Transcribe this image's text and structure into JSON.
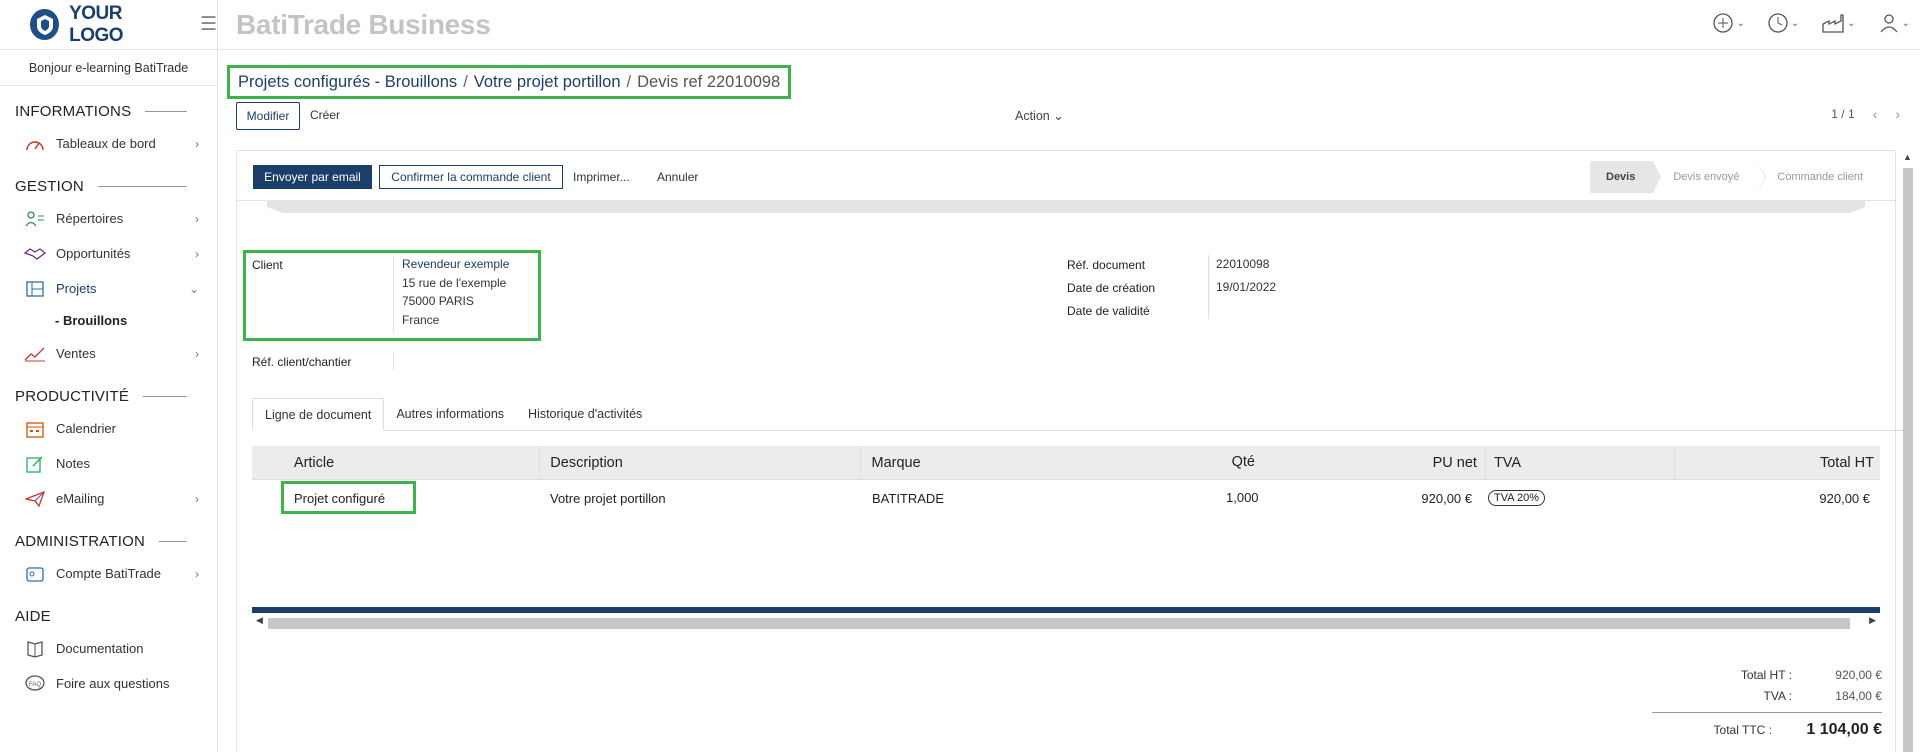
{
  "brand": {
    "logo_text": "YOUR LOGO",
    "app_title": "BatiTrade Business",
    "primary_color": "#1b3f6b",
    "highlight_color": "#3cb44b"
  },
  "sidebar": {
    "greeting": "Bonjour e-learning BatiTrade",
    "sections": [
      {
        "title": "INFORMATIONS",
        "items": [
          {
            "label": "Tableaux de bord",
            "icon": "dashboard-icon"
          }
        ]
      },
      {
        "title": "GESTION",
        "items": [
          {
            "label": "Répertoires",
            "icon": "directory-icon"
          },
          {
            "label": "Opportunités",
            "icon": "handshake-icon"
          },
          {
            "label": "Projets",
            "icon": "blueprint-icon",
            "sub": "- Brouillons"
          },
          {
            "label": "Ventes",
            "icon": "chart-line-icon"
          }
        ]
      },
      {
        "title": "PRODUCTIVITÉ",
        "items": [
          {
            "label": "Calendrier",
            "icon": "calendar-icon"
          },
          {
            "label": "Notes",
            "icon": "note-edit-icon"
          },
          {
            "label": "eMailing",
            "icon": "paper-plane-icon"
          }
        ]
      },
      {
        "title": "ADMINISTRATION",
        "items": [
          {
            "label": "Compte BatiTrade",
            "icon": "account-icon"
          }
        ]
      },
      {
        "title": "AIDE",
        "items": [
          {
            "label": "Documentation",
            "icon": "book-icon"
          },
          {
            "label": "Foire aux questions",
            "icon": "faq-icon"
          }
        ]
      }
    ]
  },
  "breadcrumb": {
    "link1": "Projets configurés - Brouillons",
    "sep": "/",
    "link2": "Votre projet portillon",
    "current": "Devis ref 22010098"
  },
  "control": {
    "edit_label": "Modifier",
    "create_label": "Créer",
    "action_label": "Action",
    "pager": "1 / 1"
  },
  "statusbar": {
    "email_label": "Envoyer par email",
    "confirm_label": "Confirmer la commande client",
    "print_label": "Imprimer...",
    "cancel_label": "Annuler",
    "stages": [
      "Devis",
      "Devis envoyé",
      "Commande client"
    ]
  },
  "fields": {
    "client_label": "Client",
    "client_name": "Revendeur exemple",
    "client_street": "15 rue de l'exemple",
    "client_city": "75000 PARIS",
    "client_country": "France",
    "ref_client_label": "Réf. client/chantier",
    "ref_doc_label": "Réf. document",
    "ref_doc_value": "22010098",
    "created_label": "Date de création",
    "created_value": "19/01/2022",
    "validity_label": "Date de validité"
  },
  "tabs": [
    "Ligne de document",
    "Autres informations",
    "Historique d'activités"
  ],
  "table": {
    "headers": {
      "article": "Article",
      "description": "Description",
      "marque": "Marque",
      "qte": "Qté",
      "pu": "PU net",
      "tva": "TVA",
      "total": "Total HT"
    },
    "rows": [
      {
        "article": "Projet configuré",
        "description": "Votre projet portillon",
        "marque": "BATITRADE",
        "qte": "1,000",
        "pu": "920,00 €",
        "tva": "TVA 20%",
        "total": "920,00 €"
      }
    ]
  },
  "totals": {
    "ht_label": "Total HT :",
    "ht_value": "920,00 €",
    "tva_label": "TVA :",
    "tva_value": "184,00 €",
    "ttc_label": "Total TTC :",
    "ttc_value": "1 104,00 €"
  }
}
